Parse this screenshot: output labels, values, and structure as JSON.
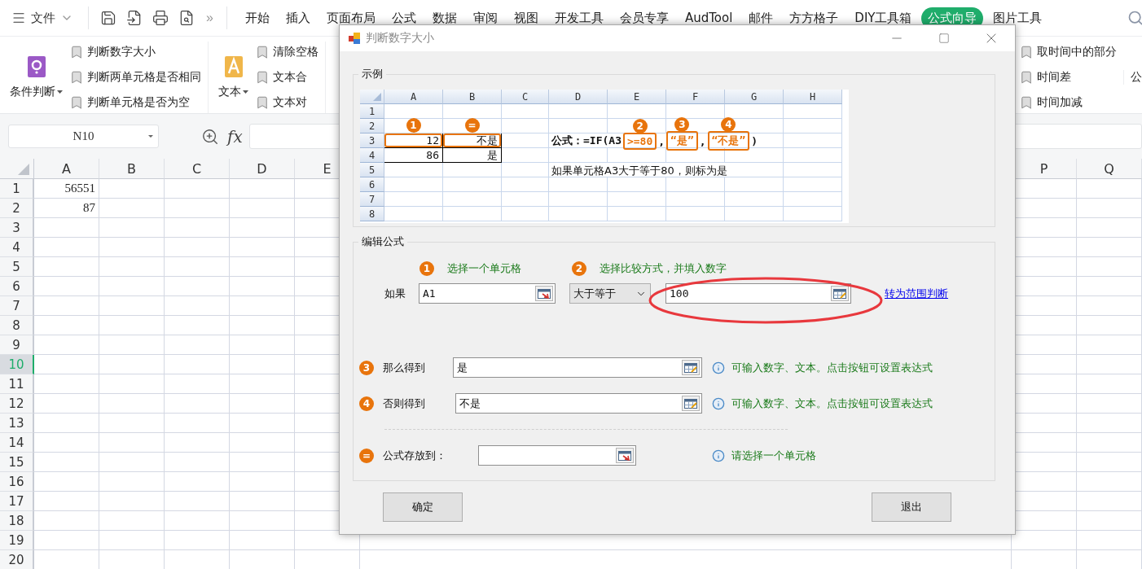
{
  "app_bar": {
    "menu": "文件",
    "more": "»",
    "tabs": [
      {
        "label": "开始",
        "selected": false
      },
      {
        "label": "插入",
        "selected": false
      },
      {
        "label": "页面布局",
        "selected": false
      },
      {
        "label": "公式",
        "selected": false
      },
      {
        "label": "数据",
        "selected": false
      },
      {
        "label": "审阅",
        "selected": false
      },
      {
        "label": "视图",
        "selected": false
      },
      {
        "label": "开发工具",
        "selected": false
      },
      {
        "label": "会员专享",
        "selected": false
      },
      {
        "label": "AudTool",
        "selected": false
      },
      {
        "label": "邮件",
        "selected": false
      },
      {
        "label": "方方格子",
        "selected": false
      },
      {
        "label": "DIY工具箱",
        "selected": false
      },
      {
        "label": "公式向导",
        "selected": true
      },
      {
        "label": "图片工具",
        "selected": false
      }
    ]
  },
  "ribbon": {
    "groups": [
      {
        "label": "条件判断",
        "items": [
          "判断数字大小",
          "判断两单元格是否相同",
          "判断单元格是否为空"
        ]
      },
      {
        "label": "文本",
        "items": [
          "清除空格",
          "文本合",
          "文本对"
        ]
      }
    ],
    "right_items": [
      "取时间中的部分",
      "时间差",
      "时间加减"
    ],
    "cut_label": "公"
  },
  "formula_bar": {
    "name_box": "N10",
    "fx": "fx"
  },
  "sheet": {
    "columns": [
      "A",
      "B",
      "C",
      "D",
      "E",
      "P",
      "Q"
    ],
    "rows": [
      {
        "label": "1",
        "selected": false,
        "cells": [
          "56551"
        ]
      },
      {
        "label": "2",
        "selected": false,
        "cells": [
          "87"
        ]
      },
      {
        "label": "3",
        "selected": false,
        "cells": []
      },
      {
        "label": "4",
        "selected": false,
        "cells": []
      },
      {
        "label": "5",
        "selected": false,
        "cells": []
      },
      {
        "label": "6",
        "selected": false,
        "cells": []
      },
      {
        "label": "7",
        "selected": false,
        "cells": []
      },
      {
        "label": "8",
        "selected": false,
        "cells": []
      },
      {
        "label": "9",
        "selected": false,
        "cells": []
      },
      {
        "label": "10",
        "selected": true,
        "cells": []
      },
      {
        "label": "11",
        "selected": false,
        "cells": []
      },
      {
        "label": "12",
        "selected": false,
        "cells": []
      },
      {
        "label": "13",
        "selected": false,
        "cells": []
      },
      {
        "label": "14",
        "selected": false,
        "cells": []
      },
      {
        "label": "15",
        "selected": false,
        "cells": []
      },
      {
        "label": "16",
        "selected": false,
        "cells": []
      },
      {
        "label": "17",
        "selected": false,
        "cells": []
      },
      {
        "label": "18",
        "selected": false,
        "cells": []
      },
      {
        "label": "19",
        "selected": false,
        "cells": []
      },
      {
        "label": "20",
        "selected": false,
        "cells": []
      }
    ]
  },
  "dialog": {
    "title": "判断数字大小",
    "example": {
      "legend": "示例",
      "columns": [
        "A",
        "B",
        "C",
        "D",
        "E",
        "F",
        "G",
        "H"
      ],
      "rows": [
        {
          "label": "1",
          "cells": []
        },
        {
          "label": "2",
          "cells": []
        },
        {
          "label": "3",
          "cells": [
            {
              "value": "12",
              "highlighted": true,
              "badge": "1"
            },
            {
              "value": "不是",
              "highlighted": true,
              "badge": "="
            }
          ],
          "formula": [
            {
              "kind": "plain",
              "text": "公式：=IF(A3"
            },
            {
              "kind": "boxed",
              "text": ">=80",
              "badge": "2"
            },
            {
              "kind": "plain",
              "text": ","
            },
            {
              "kind": "boxed",
              "text": "“是”",
              "badge": "3"
            },
            {
              "kind": "plain",
              "text": ","
            },
            {
              "kind": "boxed",
              "text": "“不是”",
              "badge": "4"
            },
            {
              "kind": "plain",
              "text": ")"
            }
          ]
        },
        {
          "label": "4",
          "cells": [
            {
              "value": "86",
              "highlighted": false
            },
            {
              "value": "是",
              "highlighted": false
            }
          ]
        },
        {
          "label": "5",
          "cells": [],
          "note": "如果单元格A3大于等于80，则标为是"
        },
        {
          "label": "6",
          "cells": []
        },
        {
          "label": "7",
          "cells": []
        },
        {
          "label": "8",
          "cells": []
        }
      ]
    },
    "edit": {
      "legend": "编辑公式",
      "hints": [
        {
          "badge": "1",
          "text": "选择一个单元格"
        },
        {
          "badge": "2",
          "text": "选择比较方式，并填入数字"
        }
      ],
      "condition": {
        "label": "如果",
        "cell": {
          "value": "A1",
          "kind": "cell"
        },
        "operator": "大于等于",
        "number": {
          "value": "100",
          "kind": "expression",
          "highlighted": true
        },
        "link": "转为范围判断"
      },
      "rows": [
        {
          "badge": "3",
          "label": "那么得到",
          "value": "是",
          "kind": "expression",
          "hint": "可输入数字、文本。点击按钮可设置表达式"
        },
        {
          "badge": "4",
          "label": "否则得到",
          "value": "不是",
          "kind": "expression",
          "hint": "可输入数字、文本。点击按钮可设置表达式"
        },
        {
          "badge": "=",
          "label": "公式存放到：",
          "kind": "cell",
          "hint": "请选择一个单元格"
        }
      ]
    },
    "buttons": [
      "确定",
      "退出"
    ]
  }
}
